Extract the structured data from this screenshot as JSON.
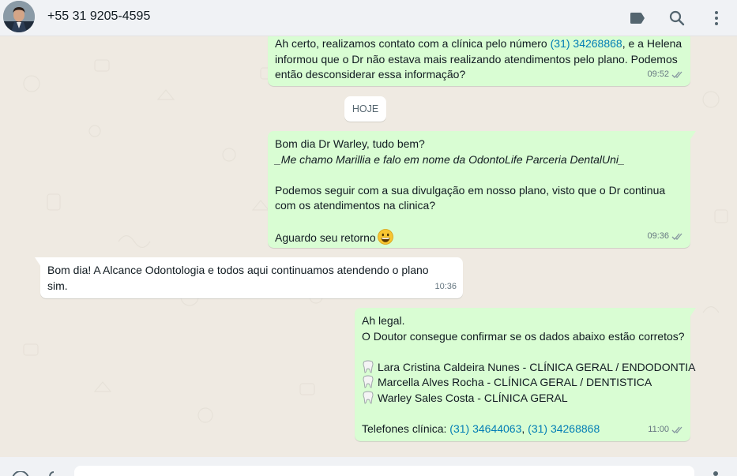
{
  "header": {
    "contact_name": "+55 31 9205-4595",
    "icons": [
      "label-icon",
      "search-icon",
      "menu-icon"
    ]
  },
  "date_separator": "HOJE",
  "messages": [
    {
      "direction": "outgoing",
      "lines": [
        "Ah certo, realizamos contato com a clínica pelo número ",
        "(31) 34268868",
        ", e a Helena",
        "informou que o Dr não estava mais realizando atendimentos pelo plano. Podemos",
        "então desconsiderar essa informação?"
      ],
      "time": "09:52"
    },
    {
      "direction": "outgoing",
      "lines": [
        "Bom dia Dr Warley, tudo bem?",
        "_Me chamo Marillia e falo em nome da OdontoLife Parceria DentalUni_",
        "",
        "Podemos seguir com a sua divulgação em nosso plano, visto que o Dr continua",
        "com os atendimentos na clinica?",
        "",
        "Aguardo seu retorno"
      ],
      "time": "09:36"
    },
    {
      "direction": "incoming",
      "lines": [
        "Bom dia! A Alcance Odontologia e todos aqui continuamos atendendo o plano",
        "sim."
      ],
      "time": "10:36"
    },
    {
      "direction": "outgoing",
      "lines": [
        "Ah legal.",
        "O Doutor consegue confirmar se os dados abaixo estão corretos?",
        "",
        "Lara Cristina Caldeira Nunes - CLÍNICA GERAL / ENDODONTIA",
        "Marcella Alves Rocha - CLÍNICA GERAL / DENTISTICA",
        "Warley Sales Costa - CLÍNICA GERAL",
        "",
        "Telefones clínica: ",
        "(31) 34644063",
        ", ",
        "(31) 34268868"
      ],
      "time": "11:00"
    }
  ],
  "colors": {
    "outgoing_bubble": "#d9fdd3",
    "incoming_bubble": "#ffffff",
    "chat_background": "#efeae2",
    "link": "#027eb5",
    "header": "#f0f2f5"
  }
}
